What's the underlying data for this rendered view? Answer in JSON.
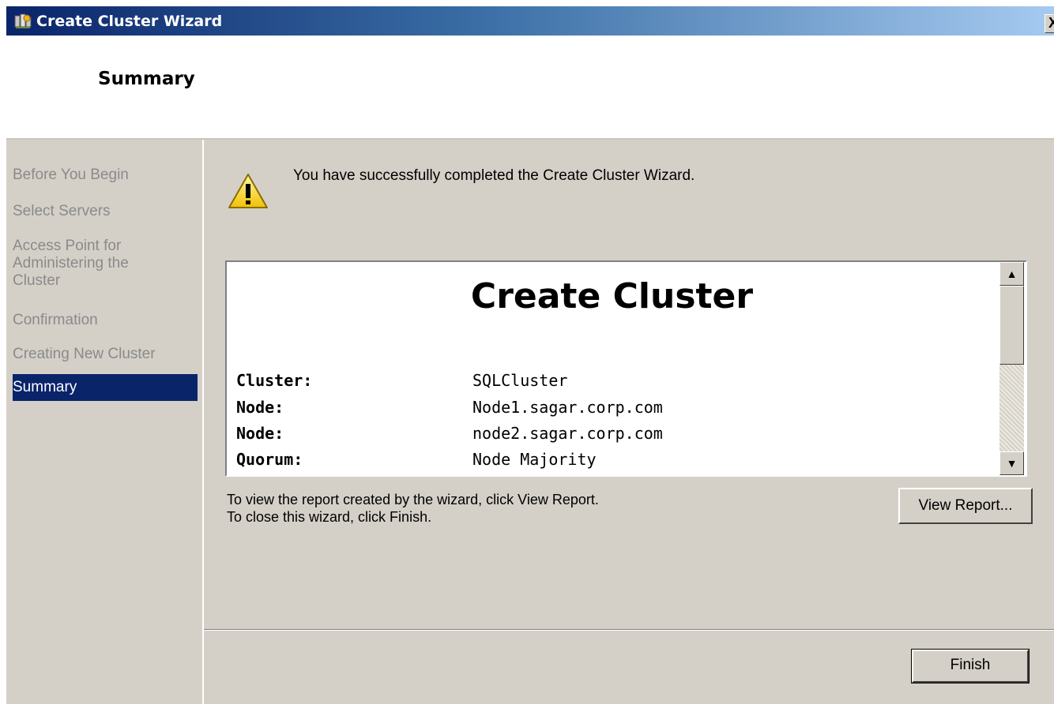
{
  "window": {
    "title": "Create Cluster Wizard",
    "close_label": "X"
  },
  "header": {
    "title": "Summary"
  },
  "nav": {
    "items": [
      {
        "label": "Before You Begin",
        "active": false
      },
      {
        "label": "Select Servers",
        "active": false
      },
      {
        "label": "Access Point for Administering the Cluster",
        "active": false
      },
      {
        "label": "Confirmation",
        "active": false
      },
      {
        "label": "Creating New Cluster",
        "active": false
      },
      {
        "label": "Summary",
        "active": true
      }
    ]
  },
  "content": {
    "success_message": "You  have successfully completed the Create Cluster Wizard.",
    "report": {
      "title": "Create Cluster",
      "rows": [
        {
          "key": "Cluster:",
          "value": "SQLCluster"
        },
        {
          "key": "Node:",
          "value": "Node1.sagar.corp.com"
        },
        {
          "key": "Node:",
          "value": "node2.sagar.corp.com"
        },
        {
          "key": "Quorum:",
          "value": "Node Majority"
        }
      ]
    },
    "info_line1": "To view the report created by the wizard, click View Report.",
    "info_line2": "To close this wizard, click Finish.",
    "view_report_label": "View Report...",
    "finish_label": "Finish"
  },
  "icons": {
    "title_icon": "cluster-icon",
    "warning_icon": "warning-icon",
    "scroll_up": "scroll-up-icon",
    "scroll_down": "scroll-down-icon"
  },
  "colors": {
    "titlebar_start": "#0a246a",
    "titlebar_end": "#a6caf0",
    "nav_active_bg": "#0a246a",
    "dialog_bg": "#d4d0c8"
  }
}
